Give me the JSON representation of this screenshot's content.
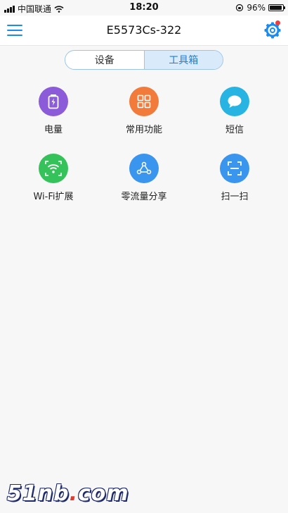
{
  "status_bar": {
    "carrier": "中国联通",
    "time": "18:20",
    "battery_percent": "96%"
  },
  "header": {
    "title": "E5573Cs-322"
  },
  "tabs": [
    {
      "label": "设备",
      "active": false
    },
    {
      "label": "工具箱",
      "active": true
    }
  ],
  "tools": [
    {
      "label": "电量",
      "icon": "battery-icon",
      "color": "#8c5bd9"
    },
    {
      "label": "常用功能",
      "icon": "grid-icon",
      "color": "#f27a3a"
    },
    {
      "label": "短信",
      "icon": "message-icon",
      "color": "#27b4e3"
    },
    {
      "label": "Wi-Fi扩展",
      "icon": "wifi-extend-icon",
      "color": "#35c25a"
    },
    {
      "label": "零流量分享",
      "icon": "share-icon",
      "color": "#3a95ef"
    },
    {
      "label": "扫一扫",
      "icon": "scan-icon",
      "color": "#3a95ef"
    }
  ],
  "watermark": {
    "text_left": "51nb",
    "dot": ".",
    "text_right": "com"
  }
}
